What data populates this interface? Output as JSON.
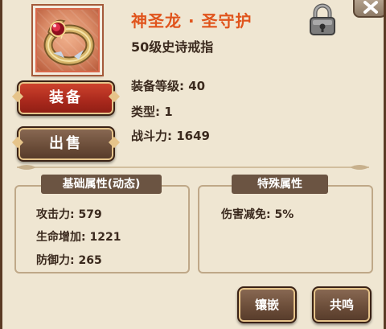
{
  "item": {
    "name": "神圣龙 · 圣守护",
    "subtitle": "50级史诗戒指",
    "icon": "ring-icon",
    "icon_bg_color": "#d8684a",
    "name_color": "#e0541c"
  },
  "stats": {
    "level": "装备等级: 40",
    "type": "类型: 1",
    "power": "战斗力: 1649"
  },
  "buttons": {
    "equip": "装备",
    "sell": "出售",
    "inlay": "镶嵌",
    "resonance": "共鸣",
    "equip_color": "#b8321f",
    "secondary_color": "#6a4c38"
  },
  "header_icons": {
    "lock": "lock-icon",
    "close": "close-icon"
  },
  "base_attributes": {
    "title": "基础属性(动态)",
    "items": [
      "攻击力: 579",
      "生命增加: 1221",
      "防御力: 265"
    ]
  },
  "special_attributes": {
    "title": "特殊属性",
    "items": [
      "伤害减免: 5%"
    ]
  }
}
